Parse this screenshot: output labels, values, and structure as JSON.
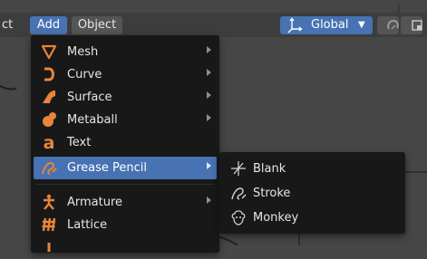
{
  "header": {
    "partial_menu": "ct",
    "add_menu": "Add",
    "object_menu": "Object",
    "orientation": "Global"
  },
  "add_menu": {
    "items": [
      {
        "label": "Mesh",
        "icon": "mesh-cone-icon",
        "has_submenu": true
      },
      {
        "label": "Curve",
        "icon": "curve-icon",
        "has_submenu": true
      },
      {
        "label": "Surface",
        "icon": "surface-icon",
        "has_submenu": true
      },
      {
        "label": "Metaball",
        "icon": "metaball-icon",
        "has_submenu": true
      },
      {
        "label": "Text",
        "icon": "text-icon",
        "has_submenu": false
      },
      {
        "label": "Grease Pencil",
        "icon": "grease-pencil-icon",
        "has_submenu": true,
        "active": true
      },
      {
        "label": "Armature",
        "icon": "armature-icon",
        "has_submenu": true
      },
      {
        "label": "Lattice",
        "icon": "lattice-icon",
        "has_submenu": false
      }
    ]
  },
  "grease_pencil_submenu": {
    "items": [
      {
        "label": "Blank",
        "icon": "blank-icon"
      },
      {
        "label": "Stroke",
        "icon": "stroke-icon"
      },
      {
        "label": "Monkey",
        "icon": "monkey-icon"
      }
    ]
  },
  "colors": {
    "accent_blue": "#4772b3",
    "menu_bg": "#181818",
    "icon_orange": "#e8843c",
    "viewport_bg": "#464646"
  }
}
